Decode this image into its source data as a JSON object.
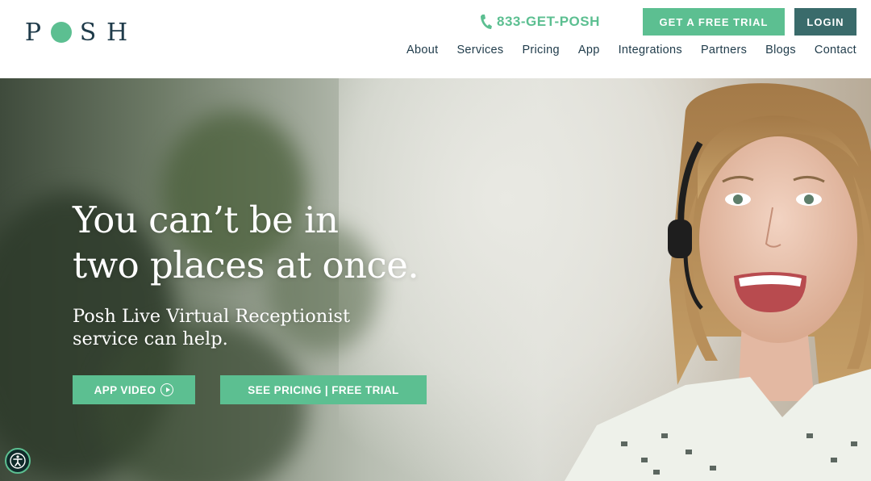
{
  "header": {
    "logo_letters": [
      "P",
      "S",
      "H"
    ],
    "phone": "833-GET-POSH",
    "trial_button": "GET A FREE TRIAL",
    "login_button": "LOGIN",
    "nav": [
      "About",
      "Services",
      "Pricing",
      "App",
      "Integrations",
      "Partners",
      "Blogs",
      "Contact"
    ]
  },
  "hero": {
    "headline_line1": "You can’t be in",
    "headline_line2": "two places at once.",
    "sub_line1": "Posh Live Virtual Receptionist",
    "sub_line2": "service can help.",
    "cta_video": "APP VIDEO",
    "cta_pricing": "SEE PRICING | FREE TRIAL"
  },
  "colors": {
    "brand_green": "#5cbf91",
    "dark_teal": "#3a6b6b",
    "navy_text": "#1f3b4a"
  },
  "icons": {
    "phone": "phone-icon",
    "play": "play-circle-icon",
    "accessibility": "accessibility-icon"
  }
}
